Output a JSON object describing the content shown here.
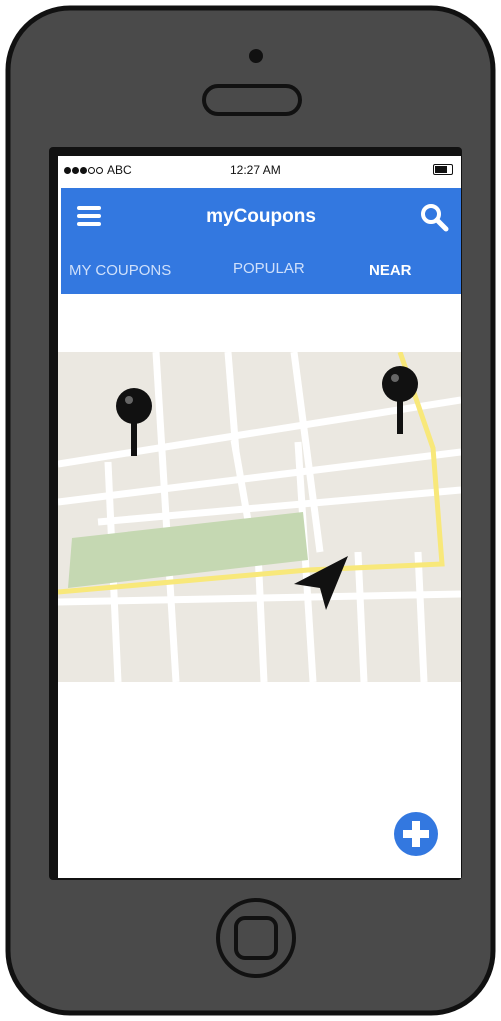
{
  "status_bar": {
    "carrier": "ABC",
    "time": "12:27 AM"
  },
  "app_bar": {
    "title": "myCoupons"
  },
  "tabs": [
    {
      "label": "MY COUPONS",
      "active": false
    },
    {
      "label": "POPULAR",
      "active": false
    },
    {
      "label": "NEAR",
      "active": true
    }
  ],
  "colors": {
    "accent": "#3378e0",
    "phone_body": "#4a4a4a",
    "map_bg": "#ebe8e1",
    "park": "#c5d8b2",
    "route": "#f8e87a"
  },
  "icons": [
    "menu-icon",
    "search-icon",
    "map-pin-icon",
    "navigation-arrow-icon",
    "add-circle-icon",
    "home-button-icon"
  ]
}
